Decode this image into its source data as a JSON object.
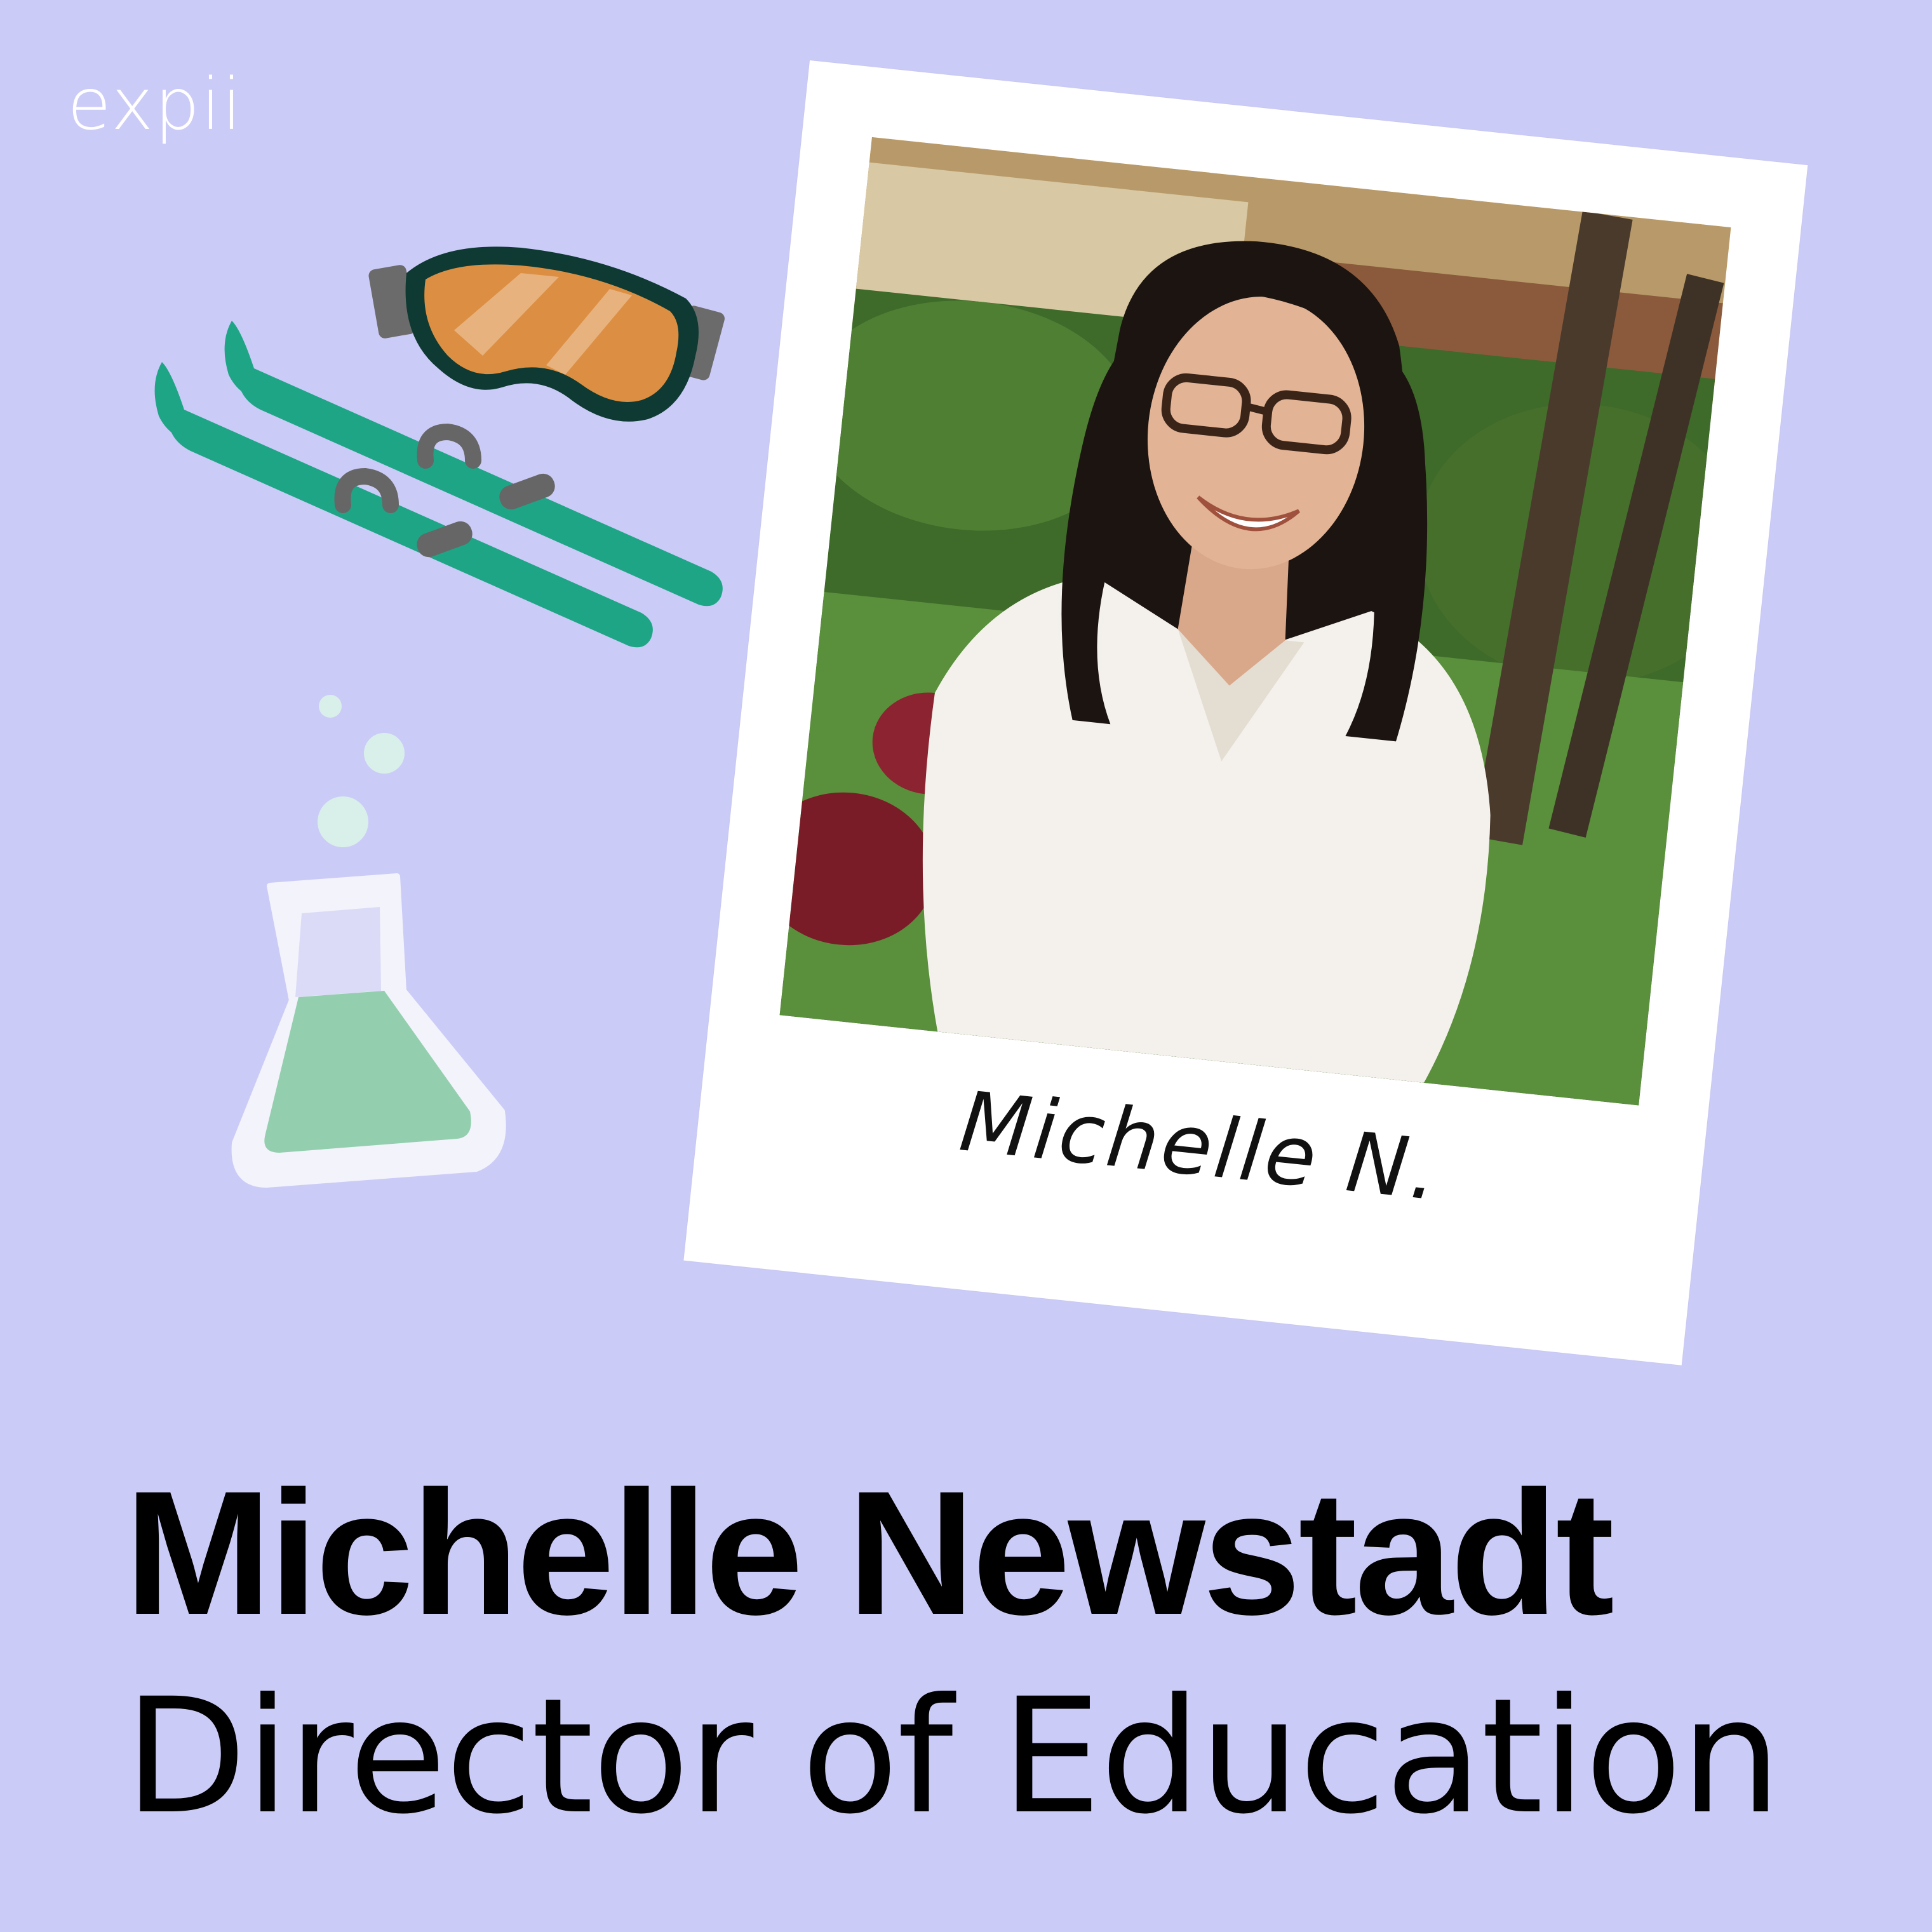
{
  "brand": {
    "logo_text": "expii"
  },
  "polaroid": {
    "signature": "Michelle N.",
    "photo_icon": "portrait-photo"
  },
  "profile": {
    "name": "Michelle Newstadt",
    "title": "Director of Education"
  },
  "illustrations": {
    "goggles_icon": "ski-goggles-icon",
    "skis_icon": "skis-icon",
    "flask_icon": "chemistry-flask-icon"
  },
  "colors": {
    "background": "#cbcbf7",
    "ski_green": "#1ea586",
    "goggle_lens": "#dc8f42",
    "flask_liquid": "#93cfae"
  }
}
